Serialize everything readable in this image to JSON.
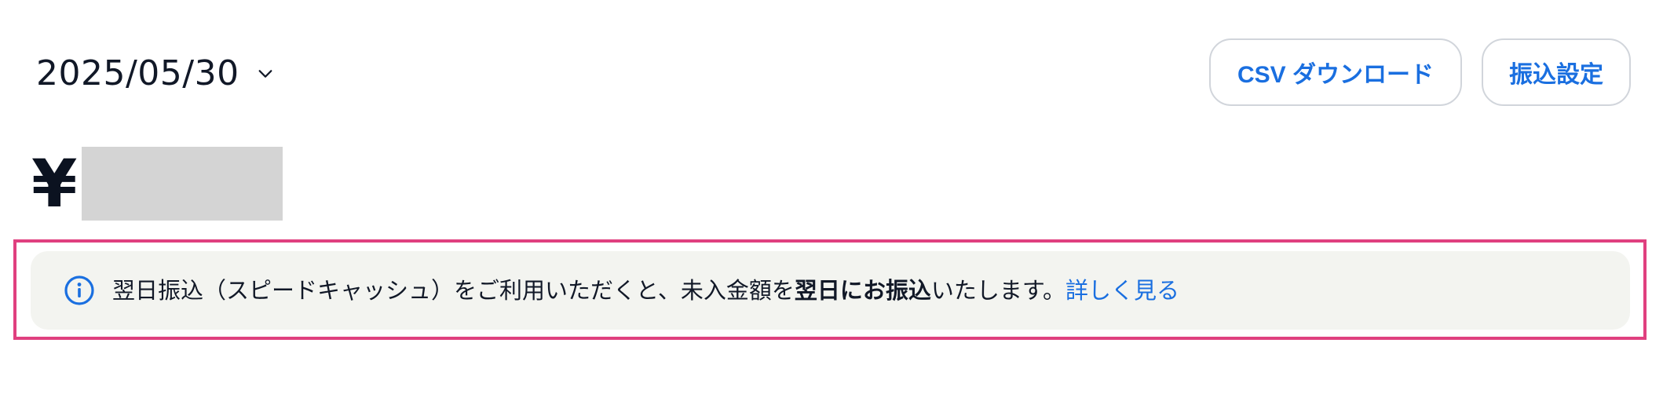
{
  "date_selector": {
    "value": "2025/05/30",
    "icon": "chevron-down-icon"
  },
  "toolbar": {
    "csv_download_label": "CSV ダウンロード",
    "transfer_settings_label": "振込設定"
  },
  "balance": {
    "currency_symbol": "¥"
  },
  "notice": {
    "icon": "info-icon",
    "text_before": "翌日振込（スピードキャッシュ）をご利用いただくと、未入金額を",
    "text_bold": "翌日にお振込",
    "text_after": "いたします。",
    "link_label": "詳しく見る"
  },
  "colors": {
    "accent": "#1a6fe0",
    "highlight": "#e0407f",
    "banner_bg": "#f3f4f0"
  }
}
